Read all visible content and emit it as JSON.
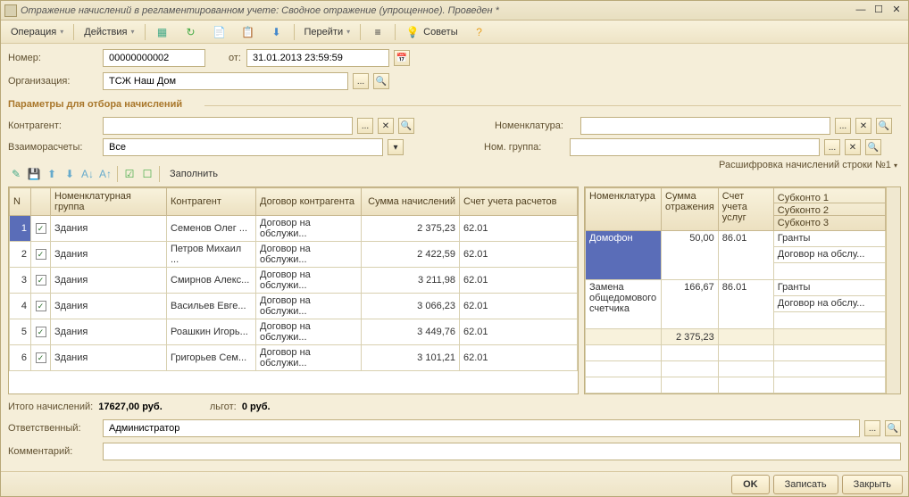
{
  "window": {
    "title": "Отражение начислений в регламентированном учете: Сводное отражение (упрощенное). Проведен *"
  },
  "toolbar": {
    "operation": "Операция",
    "actions": "Действия",
    "goto": "Перейти",
    "tips": "Советы"
  },
  "header": {
    "number_label": "Номер:",
    "number": "00000000002",
    "from_label": "от:",
    "date": "31.01.2013 23:59:59",
    "org_label": "Организация:",
    "org": "ТСЖ Наш Дом"
  },
  "filters": {
    "title": "Параметры для отбора начислений",
    "counterparty_label": "Контрагент:",
    "settlements_label": "Взаиморасчеты:",
    "settlements_value": "Все",
    "nomenclature_label": "Номенклатура:",
    "nomgroup_label": "Ном. группа:"
  },
  "grid_toolbar": {
    "fill": "Заполнить"
  },
  "left_grid": {
    "cols": [
      "N",
      "",
      "Номенклатурная группа",
      "Контрагент",
      "Договор контрагента",
      "Сумма начислений",
      "Счет учета расчетов"
    ],
    "rows": [
      {
        "n": "1",
        "chk": true,
        "ng": "Здания",
        "cp": "Семенов Олег ...",
        "dog": "Договор на обслужи...",
        "sum": "2 375,23",
        "acct": "62.01"
      },
      {
        "n": "2",
        "chk": true,
        "ng": "Здания",
        "cp": "Петров Михаил ...",
        "dog": "Договор на обслужи...",
        "sum": "2 422,59",
        "acct": "62.01"
      },
      {
        "n": "3",
        "chk": true,
        "ng": "Здания",
        "cp": "Смирнов Алекс...",
        "dog": "Договор на обслужи...",
        "sum": "3 211,98",
        "acct": "62.01"
      },
      {
        "n": "4",
        "chk": true,
        "ng": "Здания",
        "cp": "Васильев Евге...",
        "dog": "Договор на обслужи...",
        "sum": "3 066,23",
        "acct": "62.01"
      },
      {
        "n": "5",
        "chk": true,
        "ng": "Здания",
        "cp": "Роашкин Игорь...",
        "dog": "Договор на обслужи...",
        "sum": "3 449,76",
        "acct": "62.01"
      },
      {
        "n": "6",
        "chk": true,
        "ng": "Здания",
        "cp": "Григорьев Сем...",
        "dog": "Договор на обслужи...",
        "sum": "3 101,21",
        "acct": "62.01"
      }
    ]
  },
  "right_grid": {
    "title": "Расшифровка начислений строки №1",
    "cols": [
      "Номенклатура",
      "Сумма отражения",
      "Счет учета услуг",
      "Субконто 1",
      "Субконто 2",
      "Субконто 3"
    ],
    "rows": [
      {
        "nom": "Домофон",
        "sum": "50,00",
        "acct": "86.01",
        "sub": [
          "Гранты",
          "Договор на обслу..."
        ],
        "sel": true
      },
      {
        "nom": "Замена общедомового счетчика",
        "sum": "166,67",
        "acct": "86.01",
        "sub": [
          "Гранты",
          "Договор на обслу..."
        ]
      }
    ],
    "total": "2 375,23"
  },
  "totals": {
    "label": "Итого начислений:",
    "value": "17627,00 руб.",
    "benefits_label": "льгот:",
    "benefits_value": "0 руб."
  },
  "responsible": {
    "label": "Ответственный:",
    "value": "Администратор"
  },
  "comment": {
    "label": "Комментарий:"
  },
  "buttons": {
    "ok": "OK",
    "save": "Записать",
    "close": "Закрыть"
  }
}
